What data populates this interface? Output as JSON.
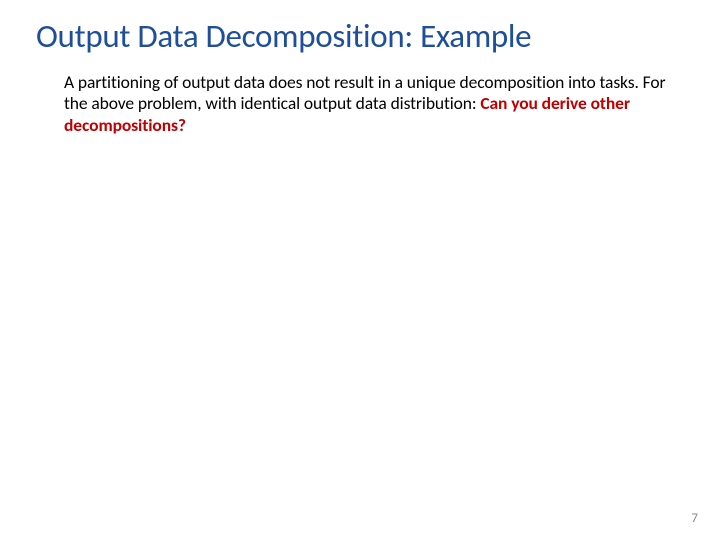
{
  "slide": {
    "title": "Output Data Decomposition: Example",
    "body_line1": "A partitioning of output data does not result in a unique decomposition",
    "body_line2": "into tasks. For the above problem, with identical output data distribution:",
    "body_highlight": "Can you derive other decompositions?",
    "page_number": "7"
  }
}
